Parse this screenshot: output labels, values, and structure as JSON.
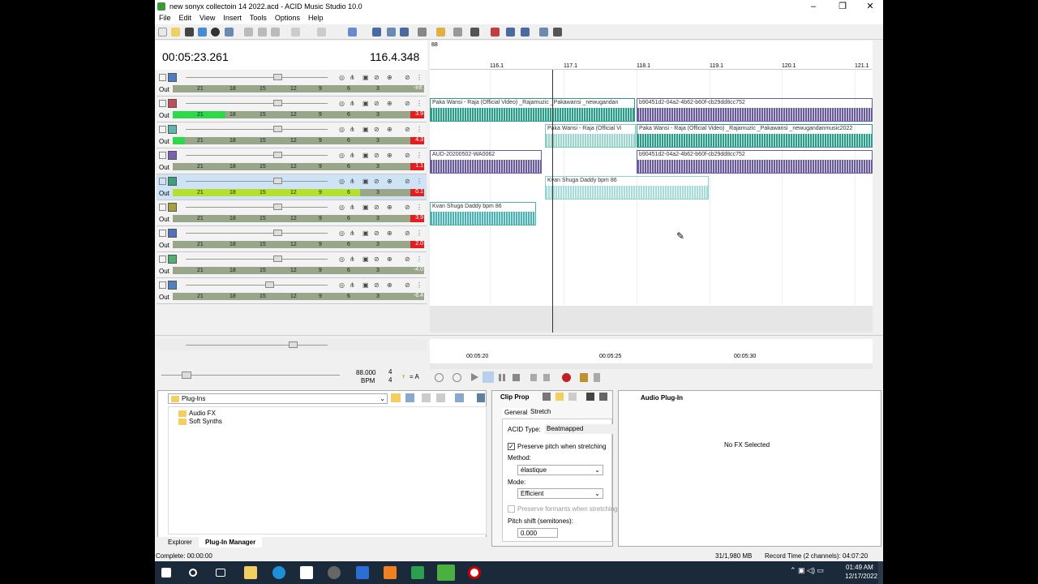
{
  "window": {
    "title": "new sonyx collectoin 14 2022.acd - ACID Music Studio 10.0"
  },
  "menu": [
    "File",
    "Edit",
    "View",
    "Insert",
    "Tools",
    "Options",
    "Help"
  ],
  "time": {
    "position": "00:05:23.261",
    "measure": "116.4.348"
  },
  "ruler": {
    "marker": "88",
    "measures": [
      "116.1",
      "117.1",
      "118.1",
      "119.1",
      "120.1",
      "121.1"
    ],
    "times": [
      "00:05:20",
      "00:05:25",
      "00:05:30"
    ]
  },
  "tracks": [
    {
      "color": "#4d7bc4",
      "peak": "-Inf.",
      "peak_color": "#9aa68a",
      "meter": 0.0,
      "fill": "#9aa68a"
    },
    {
      "color": "#c0505a",
      "peak": "3.9",
      "peak_color": "#e02020",
      "meter": 0.22,
      "fill": "#2fd84a"
    },
    {
      "color": "#5fb5b0",
      "peak": "4.3",
      "peak_color": "#e02020",
      "meter": 0.05,
      "fill": "#2fd84a"
    },
    {
      "color": "#7a60b0",
      "peak": "1.1",
      "peak_color": "#e02020",
      "meter": 0.0,
      "fill": "#9aa68a"
    },
    {
      "color": "#3aa080",
      "peak": "0.1",
      "peak_color": "#e02020",
      "meter": 0.78,
      "fill": "#b6e030"
    },
    {
      "color": "#a6a040",
      "peak": "3.9",
      "peak_color": "#e02020",
      "meter": 0.0,
      "fill": "#9aa68a"
    },
    {
      "color": "#5070c0",
      "peak": "2.0",
      "peak_color": "#e02020",
      "meter": 0.0,
      "fill": "#9aa68a"
    },
    {
      "color": "#50b070",
      "peak": "-4.0",
      "peak_color": "#9aa68a",
      "meter": 0.0,
      "fill": "#9aa68a"
    },
    {
      "color": "#5080c0",
      "peak": "-6.4",
      "peak_color": "#9aa68a",
      "meter": 0.0,
      "fill": "#9aa68a"
    }
  ],
  "meter_ticks": [
    "21",
    "18",
    "15",
    "12",
    "9",
    "6",
    "3"
  ],
  "out_label": "Out",
  "clips": [
    {
      "label": "Paka Wansi - Raja (Official Video)  _Rajamuzic _Pakawansi _newugandan",
      "color": "#2f9a88"
    },
    {
      "label": "b90451d2-04a2-4b62-b60f-cb29dd8cc752",
      "color": "#6a5aa0"
    },
    {
      "label": "Paka Wansi - Raja (Official Vi",
      "color": "#7fc4bc"
    },
    {
      "label": "Paka Wansi - Raja (Official Video)  _Rajamuzic _Pakawansi _newugandanmusic2022",
      "color": "#2f9a88"
    },
    {
      "label": "AUD-20200502-WA0062",
      "color": "#6a5aa0"
    },
    {
      "label": "b90451d2-04a2-4b62-b60f-cb29dd8cc752",
      "color": "#6a5aa0"
    },
    {
      "label": "Kvan Shuga Daddy bpm 86",
      "color": "#8fd0c8"
    },
    {
      "label": "Kvan Shuga Daddy bpm 86",
      "color": "#4fb0b0"
    }
  ],
  "tempo": {
    "bpm": "88.000",
    "bpm_label": "BPM",
    "sig_top": "4",
    "sig_bot": "4",
    "key": "= A"
  },
  "plugins": {
    "path": "Plug-Ins",
    "items": [
      "Audio FX",
      "Soft Synths"
    ],
    "tabs": [
      "Explorer",
      "Plug-In Manager"
    ]
  },
  "clip_props": {
    "title": "Clip Prop",
    "tabs": [
      "General",
      "Stretch"
    ],
    "acid_type_label": "ACID Type:",
    "acid_type": "Beatmapped",
    "preserve_pitch": "Preserve pitch when stretching",
    "method_label": "Method:",
    "method": "élastique",
    "mode_label": "Mode:",
    "mode": "Efficient",
    "preserve_formants": "Preserve formants when stretching",
    "pitch_label": "Pitch shift (semitones):",
    "pitch": "0.000"
  },
  "audio_plugin": {
    "title": "Audio Plug-In",
    "empty": "No FX Selected"
  },
  "status": {
    "left": "Complete: 00:00:00",
    "mem": "31/1,980 MB",
    "record": "Record Time (2 channels): 04:07:20"
  },
  "clock": {
    "time": "01:49 AM",
    "date": "12/17/2022"
  }
}
